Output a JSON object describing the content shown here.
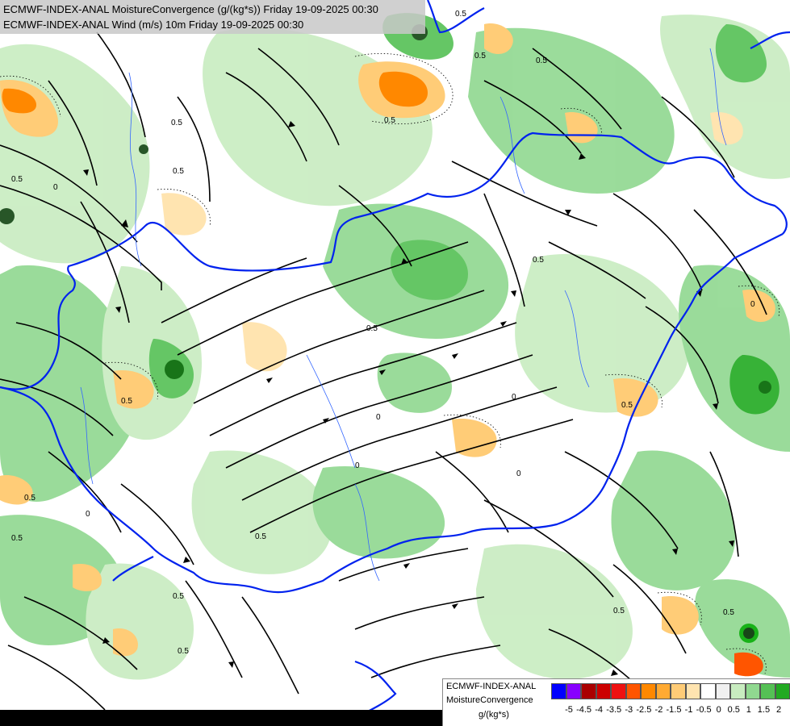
{
  "title": {
    "line1": "ECMWF-INDEX-ANAL MoistureConvergence (g/(kg*s)) Friday 19-09-2025 00:30",
    "line2": "ECMWF-INDEX-ANAL Wind (m/s) 10m Friday 19-09-2025 00:30"
  },
  "legend": {
    "line1": "ECMWF-INDEX-ANAL",
    "line2": "MoistureConvergence",
    "units": "g/(kg*s)",
    "colors": [
      "#0000ff",
      "#8800ff",
      "#aa0000",
      "#cc0000",
      "#ee1111",
      "#ff5500",
      "#ff8800",
      "#ffaa33",
      "#ffcc77",
      "#ffe4b0",
      "#ffffff",
      "#f0f0f0",
      "#c8ecc0",
      "#90d890",
      "#55c055",
      "#22aa22",
      "#00aa00"
    ],
    "ticks": [
      "-5",
      "-4.5",
      "-4",
      "-3.5",
      "-3",
      "-2.5",
      "-2",
      "-1.5",
      "-1",
      "-0.5",
      "0",
      "0.5",
      "1",
      "1.5",
      "2"
    ]
  },
  "contour_labels": [
    "0",
    "0.5"
  ]
}
